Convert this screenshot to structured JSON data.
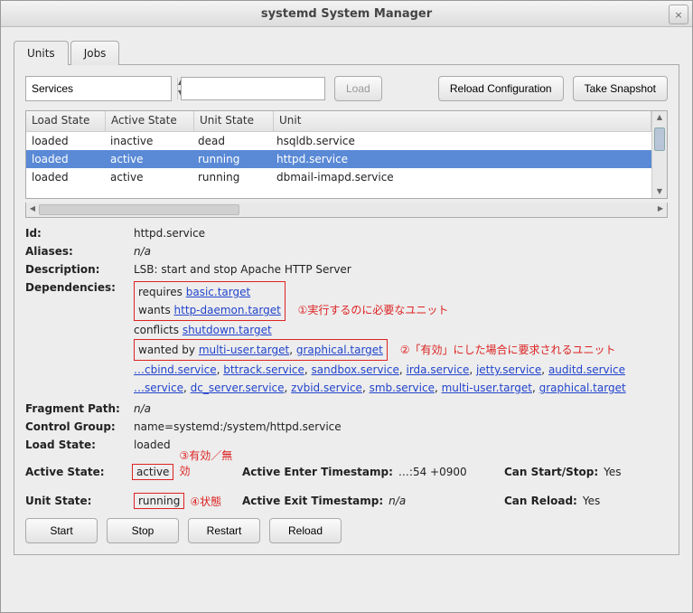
{
  "window": {
    "title": "systemd System Manager"
  },
  "tabs": {
    "units": "Units",
    "jobs": "Jobs"
  },
  "toolbar": {
    "filter": "Services",
    "load": "Load",
    "reload_config": "Reload Configuration",
    "take_snapshot": "Take Snapshot"
  },
  "table": {
    "headers": {
      "load": "Load State",
      "active": "Active State",
      "unit_state": "Unit State",
      "unit": "Unit"
    },
    "rows": [
      {
        "load": "loaded",
        "active": "inactive",
        "state": "dead",
        "unit": "hsqldb.service",
        "sel": false
      },
      {
        "load": "loaded",
        "active": "active",
        "state": "running",
        "unit": "httpd.service",
        "sel": true
      },
      {
        "load": "loaded",
        "active": "active",
        "state": "running",
        "unit": "dbmail-imapd.service",
        "sel": false
      }
    ]
  },
  "labels": {
    "id": "Id:",
    "aliases": "Aliases:",
    "description": "Description:",
    "dependencies": "Dependencies:",
    "fragment_path": "Fragment Path:",
    "control_group": "Control Group:",
    "load_state": "Load State:",
    "active_state": "Active State:",
    "unit_state": "Unit State:",
    "active_enter": "Active Enter Timestamp:",
    "active_exit": "Active Exit Timestamp:",
    "can_startstop": "Can Start/Stop:",
    "can_reload": "Can Reload:"
  },
  "detail": {
    "id": "httpd.service",
    "aliases": "n/a",
    "description": "LSB: start and stop Apache HTTP Server",
    "requires_prefix": "requires ",
    "requires_link": "basic.target",
    "wants_prefix": "wants ",
    "wants_link": "http-daemon.target",
    "conflicts_prefix": "conflicts ",
    "conflicts_link": "shutdown.target",
    "wantedby_prefix": "wanted by ",
    "wantedby_link1": "multi-user.target",
    "wantedby_link2": "graphical.target",
    "line1_prefix": "…",
    "line1_links": [
      "cbind.service",
      "bttrack.service",
      "sandbox.service",
      "irda.service",
      "jetty.service",
      "auditd.service"
    ],
    "line2_prefix": "…",
    "line2_links": [
      "service",
      "dc_server.service",
      "zvbid.service",
      "smb.service",
      "multi-user.target",
      "graphical.target"
    ],
    "fragment_path": "n/a",
    "control_group": "name=systemd:/system/httpd.service",
    "load_state": "loaded",
    "active_state": "active",
    "unit_state": "running",
    "active_enter": "…:54 +0900",
    "active_exit": "n/a",
    "can_startstop": "Yes",
    "can_reload": "Yes"
  },
  "annotations": {
    "a1": "①実行するのに必要なユニット",
    "a2": "②「有効」にした場合に要求されるユニット",
    "a3": "③有効／無効",
    "a4": "④状態"
  },
  "buttons": {
    "start": "Start",
    "stop": "Stop",
    "restart": "Restart",
    "reload": "Reload"
  }
}
